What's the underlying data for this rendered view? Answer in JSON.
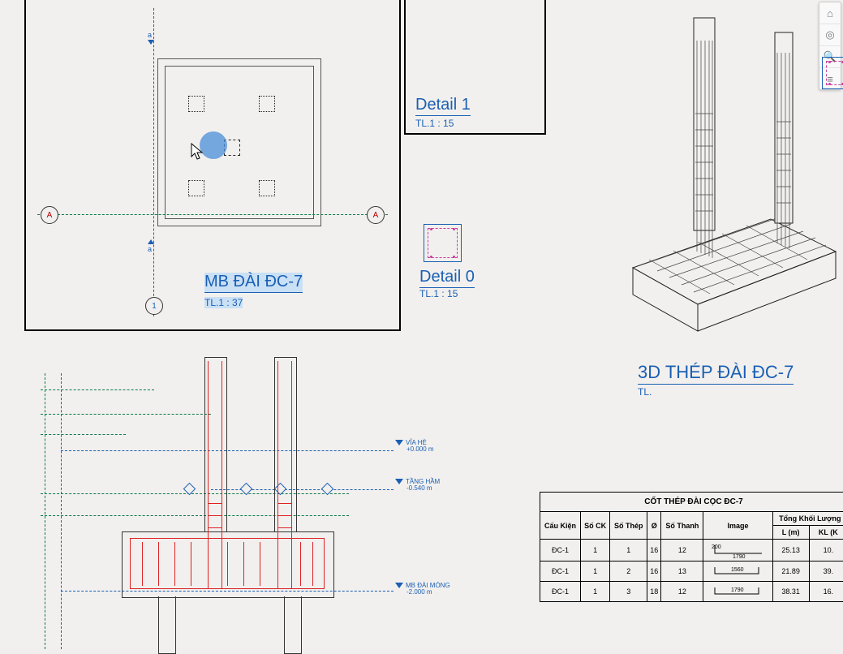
{
  "plan": {
    "title": "MB ĐÀI ĐC-7",
    "scale": "TL.1 : 37",
    "grid_h": "A",
    "grid_v": "1",
    "section_mark": "a"
  },
  "detail1": {
    "title": "Detail 1",
    "scale": "TL.1 : 15"
  },
  "detail0": {
    "title": "Detail 0",
    "scale": "TL.1 : 15"
  },
  "view3d": {
    "title": "3D THÉP ĐÀI ĐC-7",
    "scale": "TL."
  },
  "levels": {
    "via_he": {
      "name": "VỈA HÈ",
      "elev": "+0.000 m"
    },
    "tang_ham": {
      "name": "TẦNG HẦM",
      "elev": "-0.540 m"
    },
    "mb_mong": {
      "name": "MB ĐÀI MÓNG",
      "elev": "-2.000 m"
    }
  },
  "schedule": {
    "title": "CỐT THÉP ĐÀI CỌC ĐC-7",
    "headers": {
      "c1": "Cấu Kiện",
      "c2": "Số CK",
      "c3": "Số Thép",
      "c4": "Ø",
      "c5": "Số Thanh",
      "c6": "Image",
      "c7": "Tổng Khối Lượng",
      "c7a": "L (m)",
      "c7b": "KL (K"
    },
    "rows": [
      {
        "ck": "ĐC-1",
        "sock": "1",
        "sothep": "1",
        "d": "16",
        "sothanh": "12",
        "img_dims": [
          "200",
          "1790"
        ],
        "L": "25.13",
        "KL": "10."
      },
      {
        "ck": "ĐC-1",
        "sock": "1",
        "sothep": "2",
        "d": "16",
        "sothanh": "13",
        "img_dims": [
          "1560"
        ],
        "L": "21.89",
        "KL": "39."
      },
      {
        "ck": "ĐC-1",
        "sock": "1",
        "sothep": "3",
        "d": "18",
        "sothanh": "12",
        "img_dims": [
          "1790"
        ],
        "L": "38.31",
        "KL": "16."
      }
    ]
  },
  "nav": {
    "b1": "home-icon",
    "b2": "wheel-icon",
    "b3": "zoom-icon",
    "b4": "layers-icon"
  }
}
